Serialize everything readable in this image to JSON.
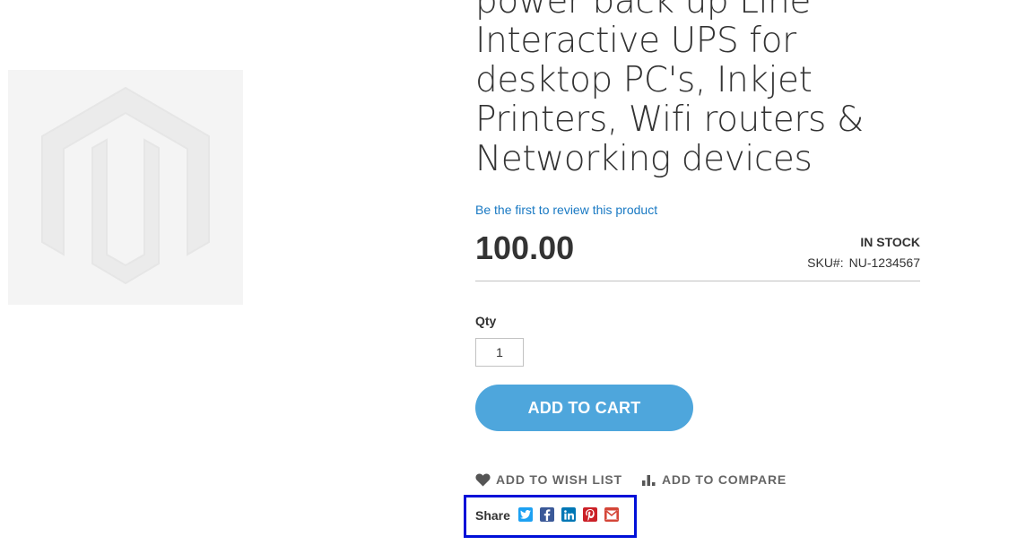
{
  "product": {
    "title": "power back up Line Interactive UPS for desktop PC's, Inkjet Printers, Wifi routers & Networking devices",
    "review_link": "Be the first to review this product",
    "price": "100.00",
    "stock_status": "IN STOCK",
    "sku_label": "SKU#:",
    "sku_value": "NU-1234567"
  },
  "form": {
    "qty_label": "Qty",
    "qty_value": "1",
    "add_to_cart_label": "ADD TO CART"
  },
  "actions": {
    "wishlist_label": "ADD TO WISH LIST",
    "compare_label": "ADD TO COMPARE"
  },
  "share": {
    "label": "Share",
    "icons": [
      "twitter-icon",
      "facebook-icon",
      "linkedin-icon",
      "pinterest-icon",
      "gmail-icon"
    ]
  },
  "colors": {
    "link": "#1979c3",
    "button": "#4ea6dc",
    "highlight_border": "#0010d8",
    "twitter": "#1da1f2",
    "facebook": "#3b5998",
    "linkedin": "#0077b5",
    "pinterest": "#cb2027",
    "gmail": "#d44638"
  }
}
